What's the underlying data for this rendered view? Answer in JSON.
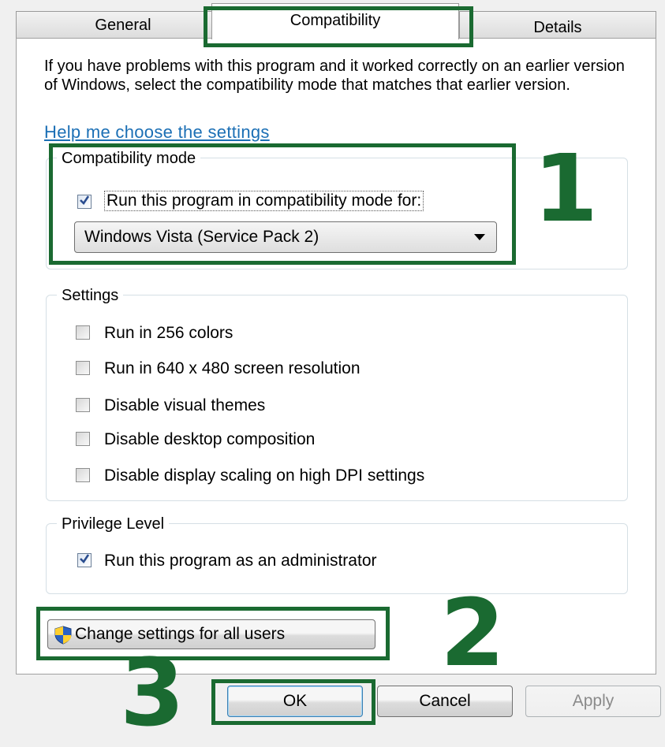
{
  "tabs": [
    {
      "label": "General"
    },
    {
      "label": "Compatibility"
    },
    {
      "label": "Details"
    }
  ],
  "description": "If you have problems with this program and it worked correctly on an earlier version of Windows, select the compatibility mode that matches that earlier version.",
  "help_link": "Help me choose the settings",
  "compat_group": {
    "legend": "Compatibility mode",
    "checkbox_label": "Run this program in compatibility mode for:",
    "checked": true,
    "selected_mode": "Windows Vista (Service Pack 2)"
  },
  "settings_group": {
    "legend": "Settings",
    "items": [
      {
        "label": "Run in 256 colors",
        "checked": false
      },
      {
        "label": "Run in 640 x 480 screen resolution",
        "checked": false
      },
      {
        "label": "Disable visual themes",
        "checked": false
      },
      {
        "label": "Disable desktop composition",
        "checked": false
      },
      {
        "label": "Disable display scaling on high DPI settings",
        "checked": false
      }
    ]
  },
  "privilege_group": {
    "legend": "Privilege Level",
    "checkbox_label": "Run this program as an administrator",
    "checked": true
  },
  "change_settings_button": "Change settings for all users",
  "buttons": {
    "ok": "OK",
    "cancel": "Cancel",
    "apply": "Apply"
  },
  "annotations": [
    "1",
    "2",
    "3"
  ],
  "colors": {
    "highlight": "#1a6a31",
    "link": "#1b6fb5"
  }
}
